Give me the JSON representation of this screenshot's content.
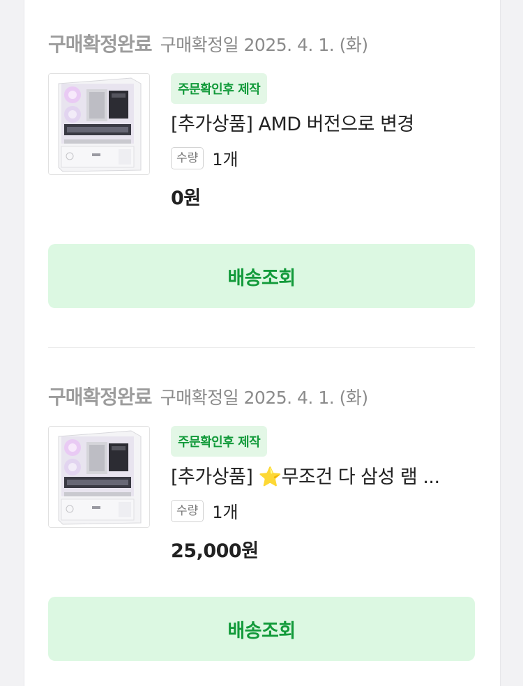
{
  "orders": [
    {
      "status": "구매확정완료",
      "confirm_date": "구매확정일 2025. 4. 1. (화)",
      "badge": "주문확인후 제작",
      "title": "[추가상품] AMD 버전으로 변경",
      "qty_label": "수량",
      "qty_value": "1개",
      "price": "0원",
      "button_label": "배송조회",
      "image_icon": "pc-case-thumbnail"
    },
    {
      "status": "구매확정완료",
      "confirm_date": "구매확정일 2025. 4. 1. (화)",
      "badge": "주문확인후 제작",
      "title_prefix": "[추가상품] ",
      "title_star": "⭐",
      "title_rest": "무조건 다 삼성 램 ...",
      "qty_label": "수량",
      "qty_value": "1개",
      "price": "25,000원",
      "button_label": "배송조회",
      "image_icon": "pc-case-thumbnail"
    }
  ],
  "colors": {
    "accent_green": "#129a3a",
    "button_bg": "#dcf8e2",
    "badge_bg": "#e3f7e6"
  }
}
